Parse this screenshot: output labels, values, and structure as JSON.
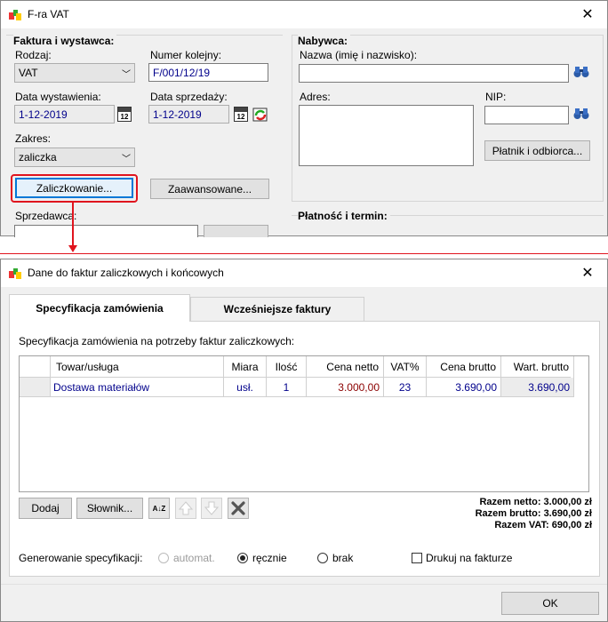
{
  "top_window": {
    "title": "F-ra VAT",
    "faktura_group": "Faktura i wystawca:",
    "rodzaj_label": "Rodzaj:",
    "rodzaj_value": "VAT",
    "numer_label": "Numer kolejny:",
    "numer_value": "F/001/12/19",
    "data_wyst_label": "Data wystawienia:",
    "data_wyst_value": "1-12-2019",
    "data_sprz_label": "Data sprzedaży:",
    "data_sprz_value": "1-12-2019",
    "calendar_day": "12",
    "zakres_label": "Zakres:",
    "zakres_value": "zaliczka",
    "zaliczkowanie_button": "Zaliczkowanie...",
    "zaawansowane_button": "Zaawansowane...",
    "sprzedawca_label": "Sprzedawca:",
    "nabywca_group": "Nabywca:",
    "nazwa_label": "Nazwa (imię i nazwisko):",
    "adres_label": "Adres:",
    "nip_label": "NIP:",
    "platnik_button": "Płatnik i odbiorca...",
    "platnosc_group": "Płatność i termin:"
  },
  "dialog": {
    "title": "Dane do faktur zaliczkowych i końcowych",
    "tabs": [
      {
        "label": "Specyfikacja zamówienia"
      },
      {
        "label": "Wcześniejsze faktury"
      }
    ],
    "description": "Specyfikacja zamówienia na potrzeby faktur zaliczkowych:",
    "table": {
      "headers": [
        "Towar/usługa",
        "Miara",
        "Ilość",
        "Cena netto",
        "VAT%",
        "Cena brutto",
        "Wart. brutto"
      ],
      "rows": [
        {
          "towar": "Dostawa materiałów",
          "miara": "usł.",
          "ilosc": "1",
          "cena_netto": "3.000,00",
          "vat": "23",
          "cena_brutto": "3.690,00",
          "wart_brutto": "3.690,00"
        }
      ]
    },
    "buttons": {
      "dodaj": "Dodaj",
      "slownik": "Słownik...",
      "ok": "OK"
    },
    "sort_icon_text": "A↓Z",
    "totals": {
      "netto": "Razem netto: 3.000,00 zł",
      "brutto": "Razem brutto: 3.690,00 zł",
      "vat": "Razem VAT: 690,00 zł"
    },
    "generowanie_label": "Generowanie specyfikacji:",
    "options": {
      "automat": "automat.",
      "recznie": "ręcznie",
      "brak": "brak",
      "drukuj": "Drukuj na fakturze"
    }
  },
  "colors": {
    "accent_red": "#e0141e",
    "value_blue": "#00008b",
    "price_red": "#8b0000"
  }
}
